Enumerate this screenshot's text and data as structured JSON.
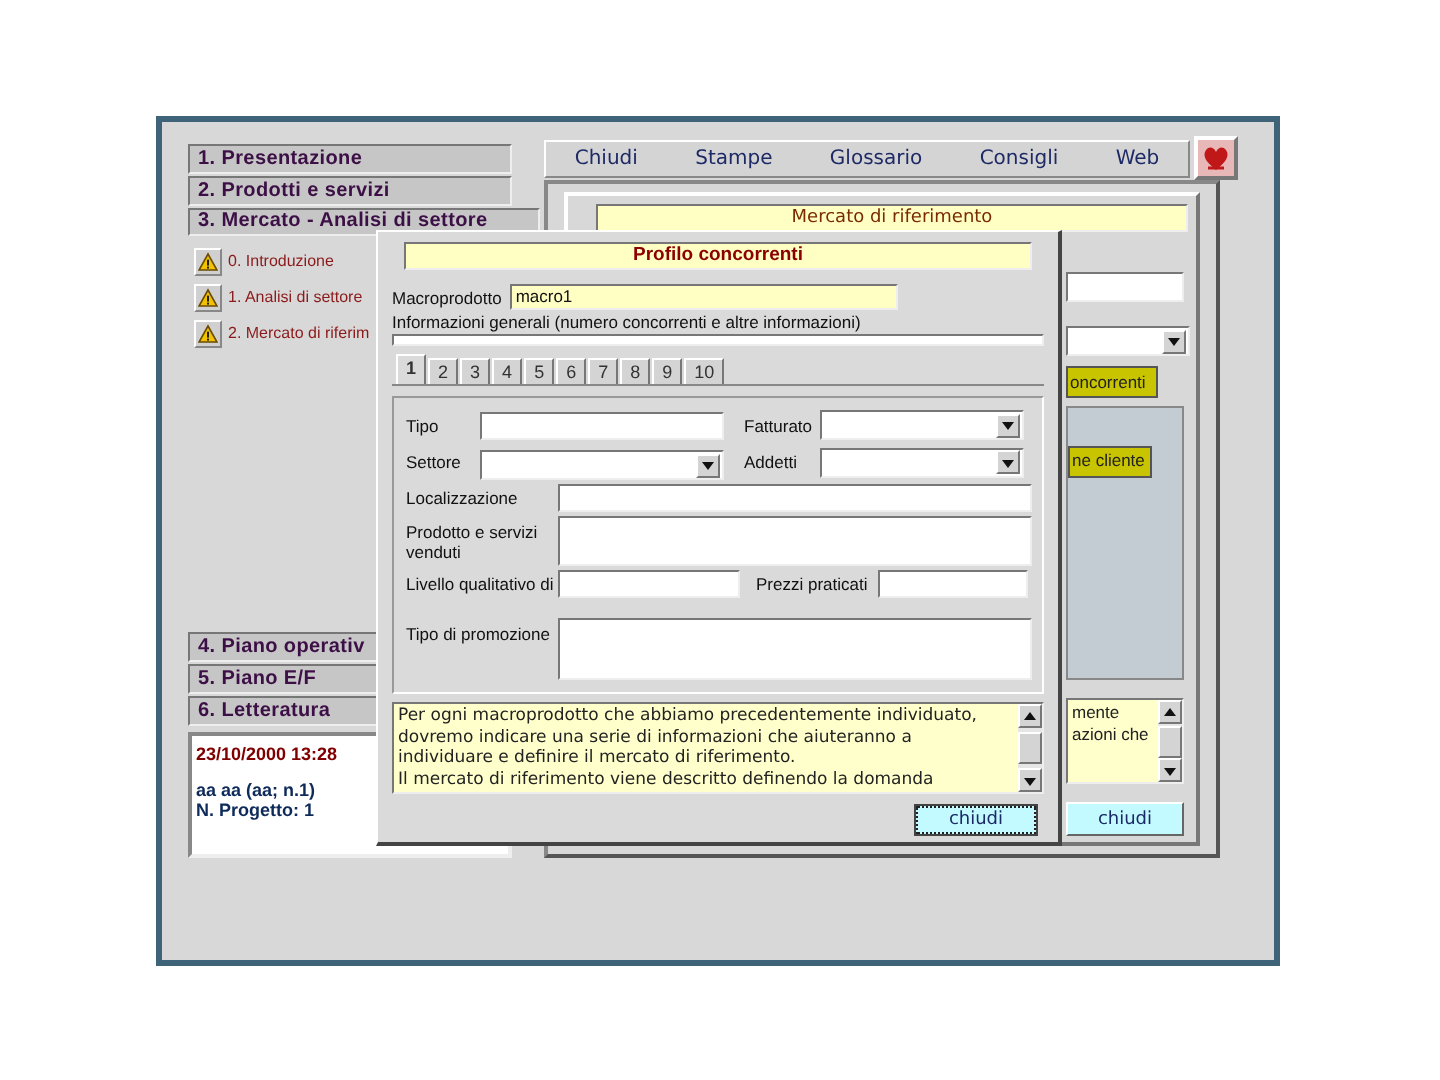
{
  "sidebar": {
    "sections": [
      {
        "label": "1. Presentazione",
        "expanded": false
      },
      {
        "label": "2. Prodotti e servizi",
        "expanded": false
      },
      {
        "label": "3. Mercato - Analisi di settore",
        "expanded": true,
        "items": [
          {
            "label": "0. Introduzione"
          },
          {
            "label": "1. Analisi di settore"
          },
          {
            "label": "2. Mercato di riferim"
          }
        ]
      },
      {
        "label": "4. Piano operativ",
        "expanded": false
      },
      {
        "label": "5. Piano E/F",
        "expanded": false
      },
      {
        "label": "6. Letteratura",
        "expanded": false
      }
    ],
    "info": {
      "date": "23/10/2000 13:28",
      "user": "aa aa (aa; n.1)",
      "project": "N. Progetto: 1"
    }
  },
  "menu": [
    "Chiudi",
    "Stampe",
    "Glossario",
    "Consigli",
    "Web"
  ],
  "back_window": {
    "title": "Mercato di riferimento",
    "button_1": "oncorrenti",
    "button_2": "ne cliente",
    "text_lines": [
      "mente",
      "azioni che"
    ],
    "close_button": "chiudi"
  },
  "dialog": {
    "title": "Profilo concorrenti",
    "macro_label": "Macroprodotto",
    "macro_value": "macro1",
    "info_label": "Informazioni generali (numero concorrenti e altre informazioni)",
    "tabs": [
      {
        "label": "1",
        "selected": true
      },
      {
        "label": "2",
        "selected": false
      },
      {
        "label": "3",
        "selected": false
      },
      {
        "label": "4",
        "selected": false
      },
      {
        "label": "5",
        "selected": false
      },
      {
        "label": "6",
        "selected": false
      },
      {
        "label": "7",
        "selected": false
      },
      {
        "label": "8",
        "selected": false
      },
      {
        "label": "9",
        "selected": false
      },
      {
        "label": "10",
        "selected": false
      }
    ],
    "rows": [
      {
        "kind": "compact",
        "fields": [
          {
            "label": "Tipo",
            "kind": "text"
          },
          {
            "label": "Fatturato",
            "kind": "select"
          }
        ]
      },
      {
        "kind": "compact",
        "fields": [
          {
            "label": "Settore",
            "kind": "select"
          },
          {
            "label": "Addetti",
            "kind": "select"
          }
        ]
      },
      {
        "kind": "wide",
        "fields": [
          {
            "label": "Localizzazione",
            "kind": "text"
          }
        ]
      },
      {
        "kind": "wide",
        "fields": [
          {
            "label": "Prodotto e servizi venduti",
            "kind": "tall"
          }
        ]
      },
      {
        "kind": "wide",
        "fields": [
          {
            "label": "Livello qualitativo di",
            "kind": "short"
          },
          {
            "label": "Prezzi praticati",
            "kind": "short"
          }
        ]
      },
      {
        "kind": "wide",
        "fields": [
          {
            "label": "Tipo di promozione",
            "kind": "area"
          }
        ]
      }
    ],
    "description": [
      "Per ogni macroprodotto che abbiamo precedentemente individuato,",
      "dovremo indicare una serie di informazioni che aiuteranno a",
      "individuare e definire il mercato di riferimento.",
      "Il mercato di riferimento viene descritto definendo la domanda"
    ],
    "close_button": "chiudi"
  }
}
